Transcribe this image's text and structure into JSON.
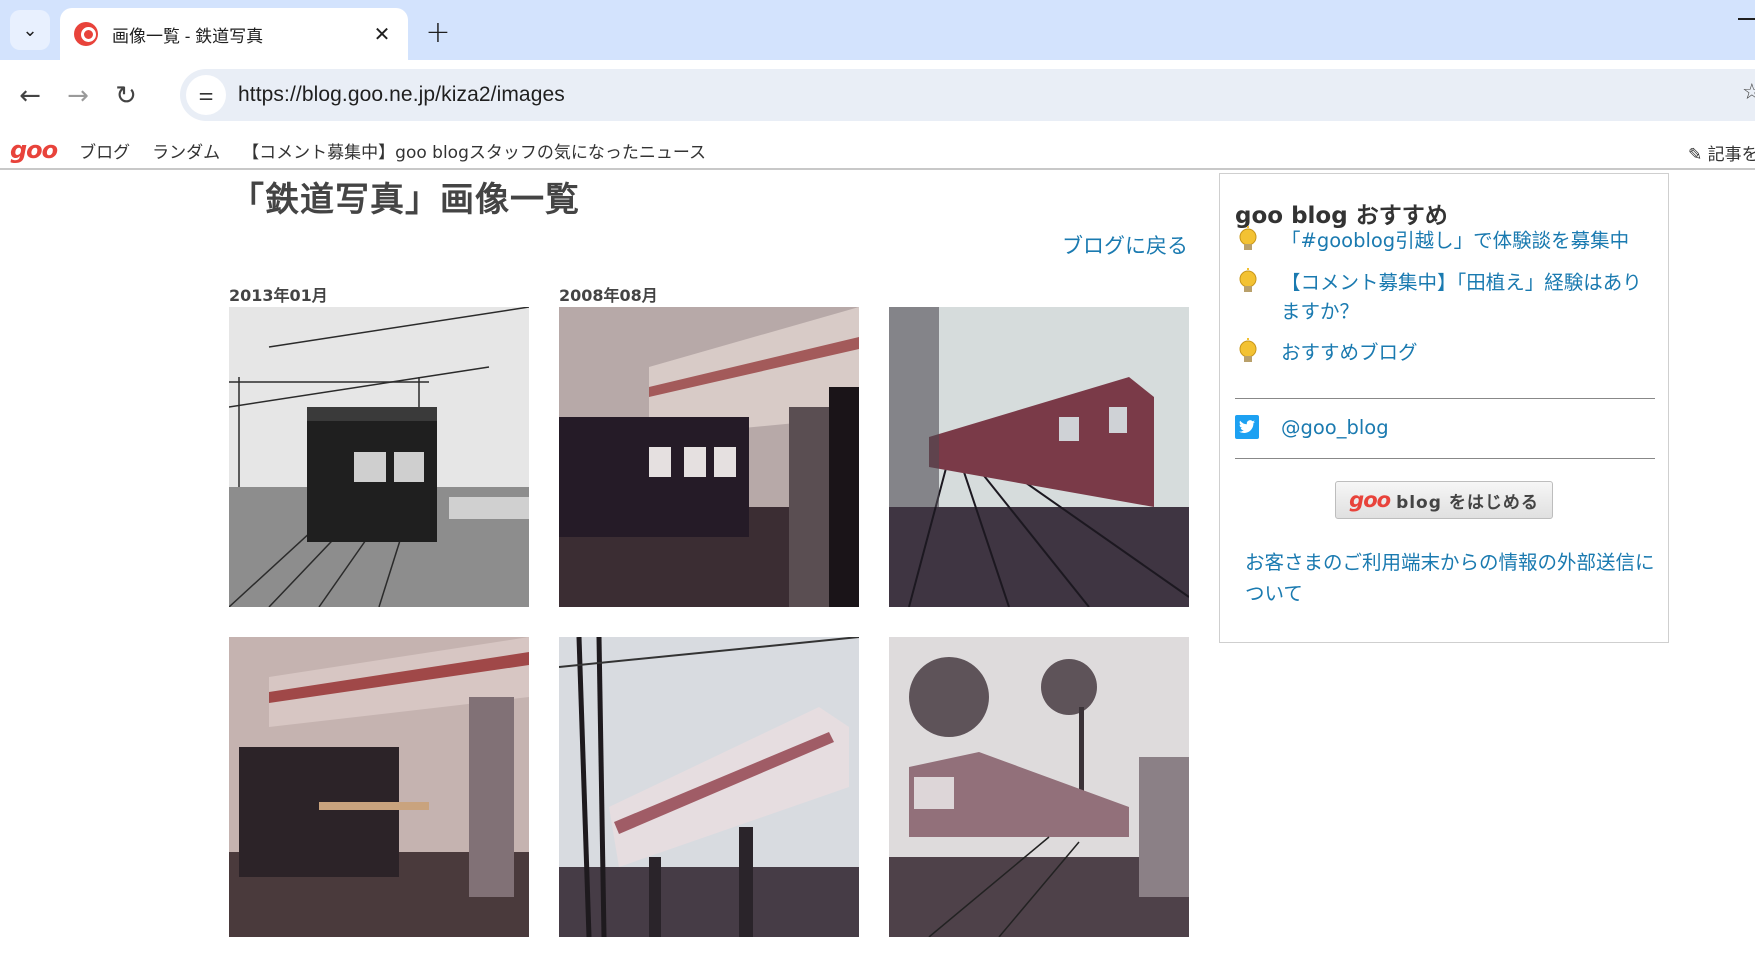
{
  "browser": {
    "tab_title": "画像一覧 - 鉄道写真",
    "url": "https://blog.goo.ne.jp/kiza2/images"
  },
  "bookmarks": {
    "logo": "goo",
    "items": [
      "ブログ",
      "ランダム",
      "【コメント募集中】goo blogスタッフの気になったニュース"
    ],
    "right_item": "記事を"
  },
  "main": {
    "title": "「鉄道写真」画像一覧",
    "back_link": "ブログに戻る",
    "months": [
      "2013年01月",
      "2008年08月"
    ],
    "images": [
      {
        "alt": "railway photo 1",
        "tone": "bw"
      },
      {
        "alt": "railway photo 2",
        "tone": "sepia"
      },
      {
        "alt": "railway photo 3",
        "tone": "faded"
      },
      {
        "alt": "railway photo 4",
        "tone": "sepia"
      },
      {
        "alt": "railway photo 5",
        "tone": "faded"
      },
      {
        "alt": "railway photo 6",
        "tone": "faded"
      }
    ]
  },
  "sidebar": {
    "title": "goo blog おすすめ",
    "links": [
      "「#gooblog引越し」で体験談を募集中",
      "【コメント募集中】「田植え」経験はありますか？",
      "おすすめブログ"
    ],
    "twitter": "@goo_blog",
    "start_button_logo": "goo",
    "start_button_text": "blog をはじめる",
    "privacy_link": "お客さまのご利用端末からの情報の外部送信について"
  },
  "colors": {
    "link": "#1a7ab0",
    "goo_red": "#e8433b",
    "tab_bar": "#d3e3fd"
  }
}
